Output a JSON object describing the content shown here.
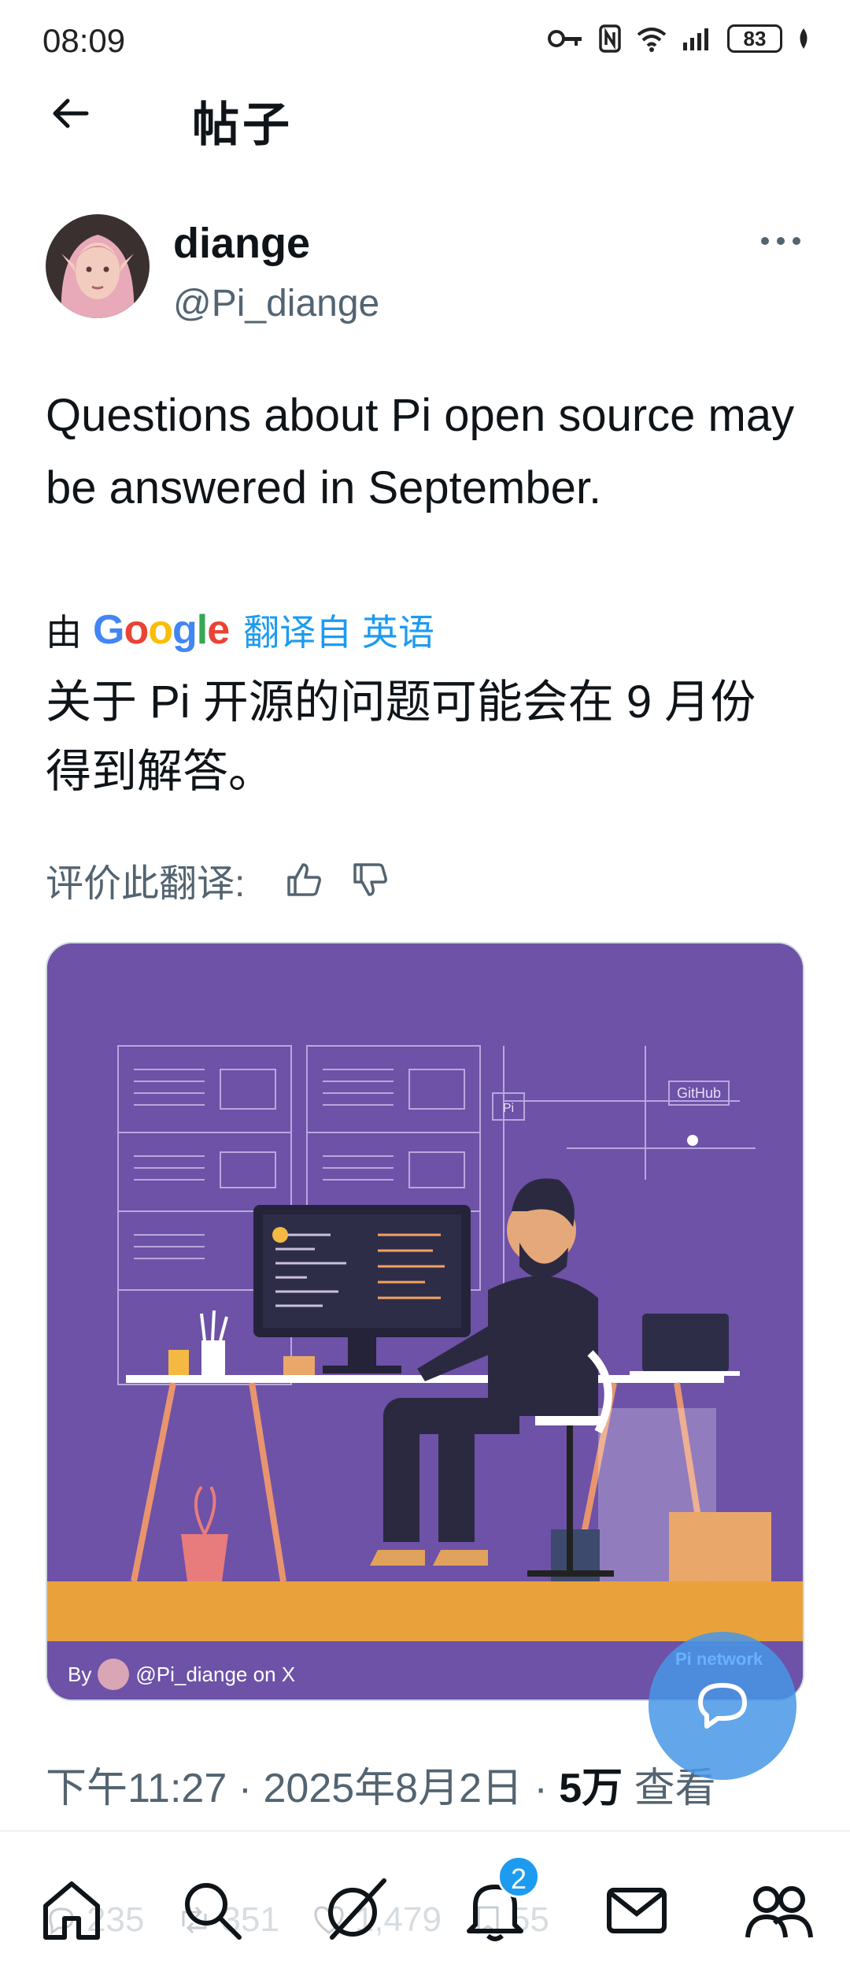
{
  "status_bar": {
    "time": "08:09",
    "battery": "83"
  },
  "header": {
    "title": "帖子"
  },
  "author": {
    "name": "diange",
    "handle": "@Pi_diange"
  },
  "tweet": {
    "text": "Questions about Pi open source may be answered in September.",
    "translated_by_prefix": "由",
    "translation_provider": "Google",
    "translated_from": "翻译自 英语",
    "translation": "关于 Pi 开源的问题可能会在 9 月份得到解答。",
    "rate_translation": "评价此翻译:"
  },
  "media": {
    "credit_prefix": "By",
    "credit_suffix": "@Pi_diange on X",
    "github_label": "GitHub",
    "pi_label": "Pi"
  },
  "meta": {
    "timestamp": "下午11:27 · 2025年8月2日 · ",
    "views": "5万",
    "views_label": " 查看"
  },
  "actions": {
    "replies": "235",
    "reposts": "351",
    "likes": "1,479",
    "bookmarks": "55"
  },
  "fab": {
    "label": "Pi network"
  },
  "nav": {
    "notifications_badge": "2"
  },
  "colors": {
    "accent": "#1d9bf0",
    "muted_text": "#536471",
    "media_bg": "#6d52a7",
    "media_floor": "#e9a23b"
  }
}
